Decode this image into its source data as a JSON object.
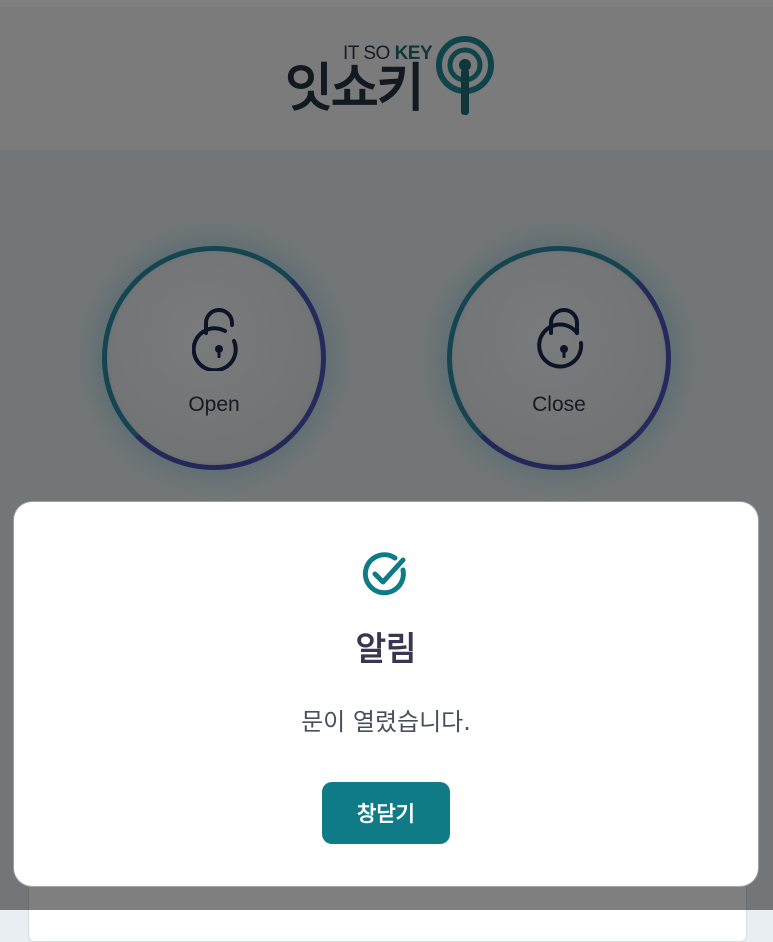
{
  "header": {
    "logo_small_prefix": "IT SO",
    "logo_small_key": "KEY",
    "logo_big": "잇쇼키"
  },
  "locks": {
    "open_label": "Open",
    "close_label": "Close"
  },
  "dialog": {
    "title": "알림",
    "message": "문이 열렸습니다.",
    "close_button_label": "창닫기"
  },
  "colors": {
    "accent": "#0f7b86",
    "ring_start": "#2a8aa0",
    "ring_end": "#4650b2",
    "text_dark": "#3a3550"
  },
  "icons": {
    "open": "unlocked-padlock-icon",
    "close": "locked-padlock-icon",
    "dialog": "check-circle-icon",
    "logo": "antenna-logo-icon"
  }
}
